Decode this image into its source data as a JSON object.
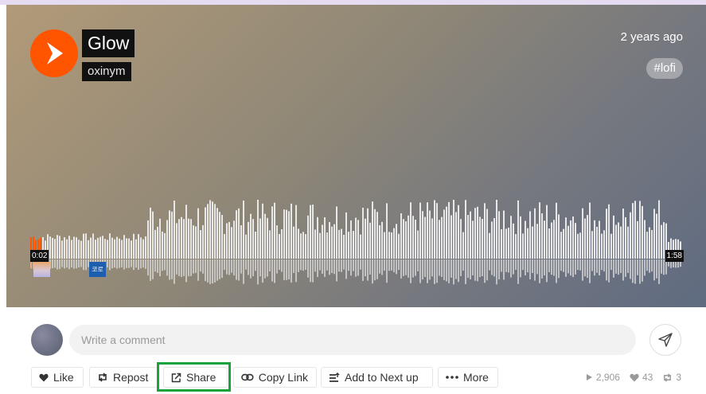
{
  "track": {
    "title": "Glow",
    "artist": "oxinym",
    "uploaded": "2 years ago",
    "tag": "lofi",
    "tag_prefix": "#"
  },
  "player": {
    "current_time": "0:02",
    "duration": "1:58",
    "progress": 0.017,
    "comment_marker_label": "코로"
  },
  "comment": {
    "placeholder": "Write a comment"
  },
  "actions": {
    "like": "Like",
    "repost": "Repost",
    "share": "Share",
    "copy_link": "Copy Link",
    "add_next": "Add to Next up",
    "more": "More"
  },
  "stats": {
    "plays": "2,906",
    "likes": "43",
    "reposts": "3"
  },
  "colors": {
    "accent": "#ff5500",
    "highlight": "#1aa33a"
  },
  "icons": [
    "play-icon",
    "heart-icon",
    "repost-icon",
    "share-icon",
    "link-icon",
    "queue-icon",
    "more-icon",
    "send-icon"
  ]
}
